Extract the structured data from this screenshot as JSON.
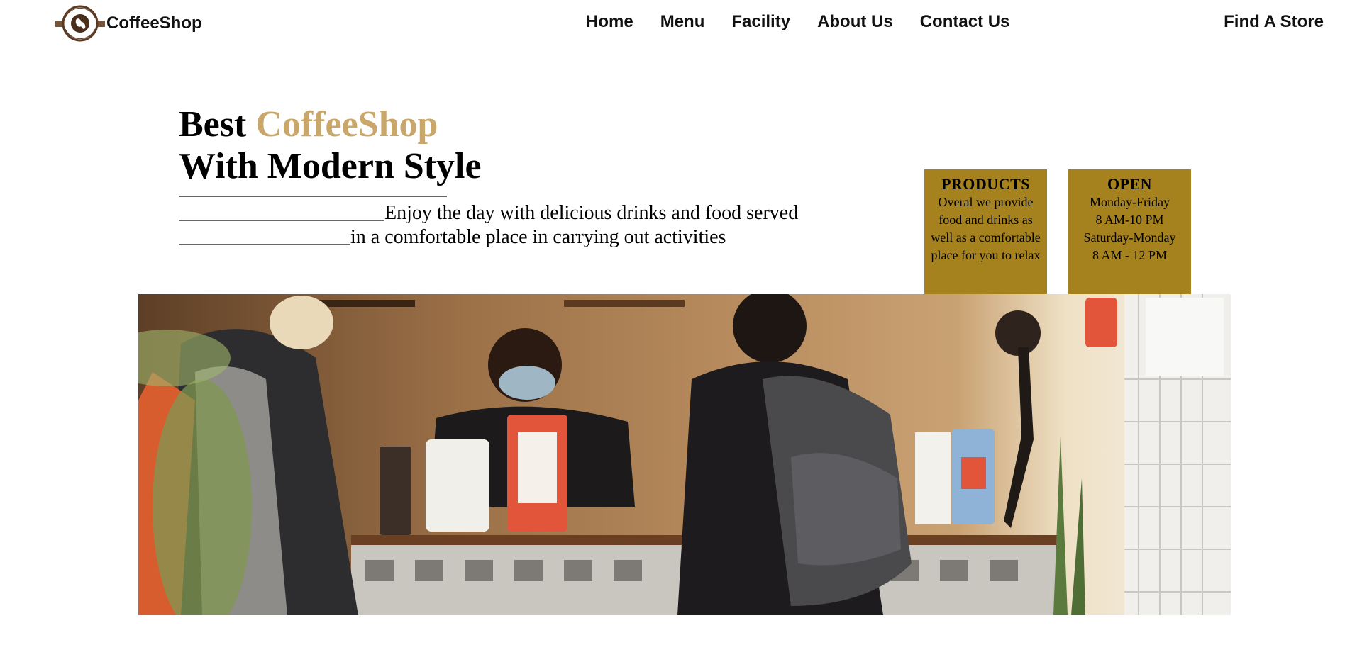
{
  "header": {
    "brand": "CoffeeShop",
    "logo_text_top": "COFFEE SHOP",
    "logo_text_bottom": "COFFEE SHOP",
    "nav": [
      "Home",
      "Menu",
      "Facility",
      "About Us",
      "Contact Us"
    ],
    "find_store": "Find A Store"
  },
  "hero": {
    "title_prefix": "Best ",
    "title_accent": "CoffeeShop",
    "title_line2": "With Modern Style",
    "desc_line1": "Enjoy the day with delicious drinks and food served",
    "desc_line2": "in a comfortable place in carrying out activities"
  },
  "info_boxes": {
    "products": {
      "title": "PRODUCTS",
      "body": [
        "Overal we provide",
        "food and drinks as",
        "well as a comfortable",
        "place for you to relax"
      ]
    },
    "open": {
      "title": "OPEN",
      "body": [
        "Monday-Friday",
        "8 AM-10 PM",
        "Saturday-Monday",
        "8 AM - 12 PM"
      ]
    }
  },
  "colors": {
    "accent": "#c9a76a",
    "box_bg": "#a6821f"
  }
}
